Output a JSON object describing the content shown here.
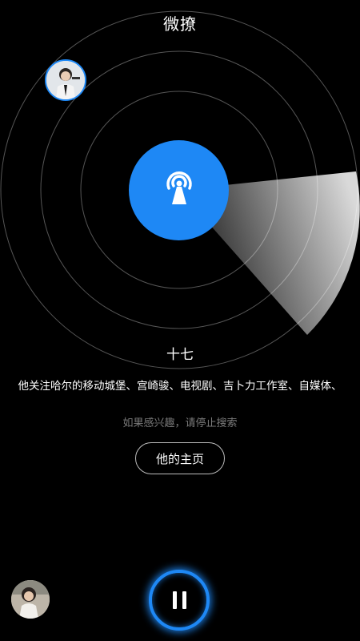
{
  "header": {
    "title": "微撩"
  },
  "radar": {
    "center_icon": "broadcast-tower-icon",
    "accent_color": "#1e88f5"
  },
  "match": {
    "username": "十七",
    "interests": "他关注哈尔的移动城堡、宫崎骏、电视剧、吉卜力工作室、自媒体、",
    "hint": "如果感兴趣，请停止搜索",
    "profile_button_label": "他的主页",
    "avatar_icon": "user-avatar"
  },
  "footer": {
    "pause_icon": "pause-icon",
    "self_avatar_icon": "self-avatar"
  }
}
